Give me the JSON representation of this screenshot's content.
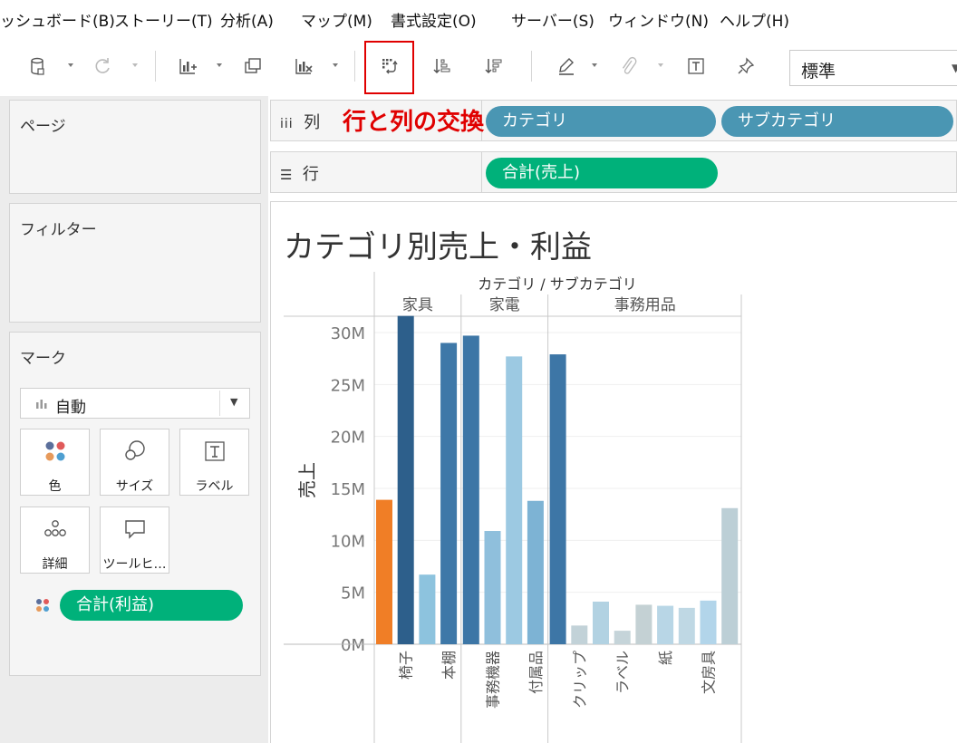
{
  "menu": [
    "ッシュボード(B)",
    "ストーリー(T)",
    "分析(A)",
    "マップ(M)",
    "書式設定(O)",
    "サーバー(S)",
    "ウィンドウ(N)",
    "ヘルプ(H)"
  ],
  "toolbar": {
    "fit_value": "標準",
    "highlight_color": "#e00000"
  },
  "annotation": "行と列の交換",
  "panels": {
    "pages": "ページ",
    "filters": "フィルター",
    "marks": "マーク",
    "marks_type": "自動",
    "mark_buttons": [
      "色",
      "サイズ",
      "ラベル",
      "詳細",
      "ツールヒ…"
    ],
    "marks_pill": "合計(利益)"
  },
  "shelves": {
    "columns_label": "列",
    "rows_label": "行",
    "columns_pills": [
      "カテゴリ",
      "サブカテゴリ"
    ],
    "rows_pills": [
      "合計(売上)"
    ]
  },
  "colors": {
    "green": "#00b17a",
    "blue_pill": "#4a96b3",
    "annotation": "#e00000"
  },
  "chart_data": {
    "type": "bar",
    "title": "カテゴリ別売上・利益",
    "header": "カテゴリ / サブカテゴリ",
    "ylabel": "売上",
    "ylim": [
      0,
      33
    ],
    "yticks": [
      "0M",
      "5M",
      "10M",
      "15M",
      "20M",
      "25M",
      "30M"
    ],
    "ytick_values": [
      0,
      5,
      10,
      15,
      20,
      25,
      30
    ],
    "groups": [
      {
        "name": "家具",
        "items": [
          {
            "label": "",
            "value": 13.9,
            "color": "#f07e26"
          },
          {
            "label": "椅子",
            "value": 31.6,
            "color": "#2d5f8b"
          },
          {
            "label": "",
            "value": 6.7,
            "color": "#8dc3de"
          },
          {
            "label": "本棚",
            "value": 29.0,
            "color": "#3e78a8"
          }
        ]
      },
      {
        "name": "家電",
        "items": [
          {
            "label": "",
            "value": 29.7,
            "color": "#3d76a6"
          },
          {
            "label": "事務機器",
            "value": 10.9,
            "color": "#8fbfdc"
          },
          {
            "label": "",
            "value": 27.7,
            "color": "#9cc9e2"
          },
          {
            "label": "付属品",
            "value": 13.8,
            "color": "#7db3d4"
          }
        ]
      },
      {
        "name": "事務用品",
        "items": [
          {
            "label": "",
            "value": 27.9,
            "color": "#3d76a6"
          },
          {
            "label": "クリップ",
            "value": 1.8,
            "color": "#c2d2d8"
          },
          {
            "label": "",
            "value": 4.1,
            "color": "#b2d2e2"
          },
          {
            "label": "ラベル",
            "value": 1.3,
            "color": "#c5d4d9"
          },
          {
            "label": "",
            "value": 3.8,
            "color": "#c4d1d4"
          },
          {
            "label": "紙",
            "value": 3.7,
            "color": "#b8d6e6"
          },
          {
            "label": "",
            "value": 3.5,
            "color": "#bfd8e4"
          },
          {
            "label": "文房具",
            "value": 4.2,
            "color": "#b2d5ea"
          },
          {
            "label": "",
            "value": 13.1,
            "color": "#bccfd6"
          }
        ]
      }
    ]
  }
}
